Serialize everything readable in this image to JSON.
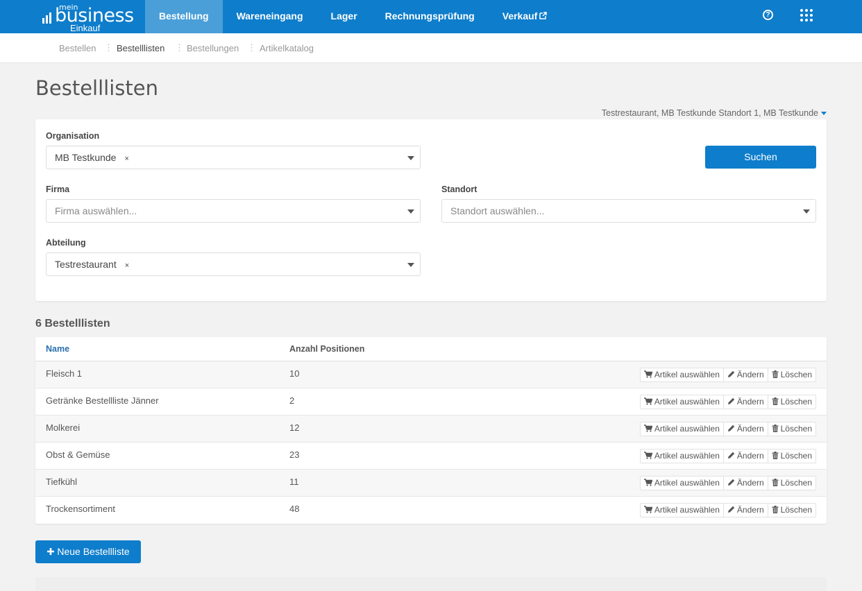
{
  "brand": {
    "mein": "mein",
    "business": "business",
    "einkauf": "Einkauf"
  },
  "nav": {
    "items": [
      {
        "label": "Bestellung",
        "active": true
      },
      {
        "label": "Wareneingang",
        "active": false
      },
      {
        "label": "Lager",
        "active": false
      },
      {
        "label": "Rechnungsprüfung",
        "active": false
      },
      {
        "label": "Verkauf",
        "active": false,
        "external": true
      }
    ],
    "help_icon": "question-circle-icon",
    "apps_icon": "grid-apps-icon"
  },
  "subnav": {
    "items": [
      "Bestellen",
      "Bestelllisten",
      "Bestellungen",
      "Artikelkatalog"
    ],
    "active": "Bestelllisten"
  },
  "page": {
    "title": "Bestelllisten",
    "context": "Testrestaurant, MB Testkunde Standort 1, MB Testkunde"
  },
  "filters": {
    "organisation": {
      "label": "Organisation",
      "value": "MB Testkunde",
      "clear": "×"
    },
    "firma": {
      "label": "Firma",
      "placeholder": "Firma auswählen..."
    },
    "standort": {
      "label": "Standort",
      "placeholder": "Standort auswählen..."
    },
    "abteilung": {
      "label": "Abteilung",
      "value": "Testrestaurant",
      "clear": "×"
    },
    "search_button": "Suchen"
  },
  "list": {
    "count_title": "6 Bestelllisten",
    "columns": {
      "name": "Name",
      "count": "Anzahl Positionen"
    },
    "rows": [
      {
        "name": "Fleisch 1",
        "count": "10"
      },
      {
        "name": "Getränke Bestellliste Jänner",
        "count": "2"
      },
      {
        "name": "Molkerei",
        "count": "12"
      },
      {
        "name": "Obst & Gemüse",
        "count": "23"
      },
      {
        "name": "Tiefkühl",
        "count": "11"
      },
      {
        "name": "Trockensortiment",
        "count": "48"
      }
    ],
    "actions": {
      "select": "Artikel auswählen",
      "edit": "Ändern",
      "delete": "Löschen"
    }
  },
  "new_button": "Neue Bestellliste",
  "colors": {
    "primary": "#0e7dcb",
    "nav_active": "#4a9fd9",
    "background": "#f2f2f2"
  }
}
